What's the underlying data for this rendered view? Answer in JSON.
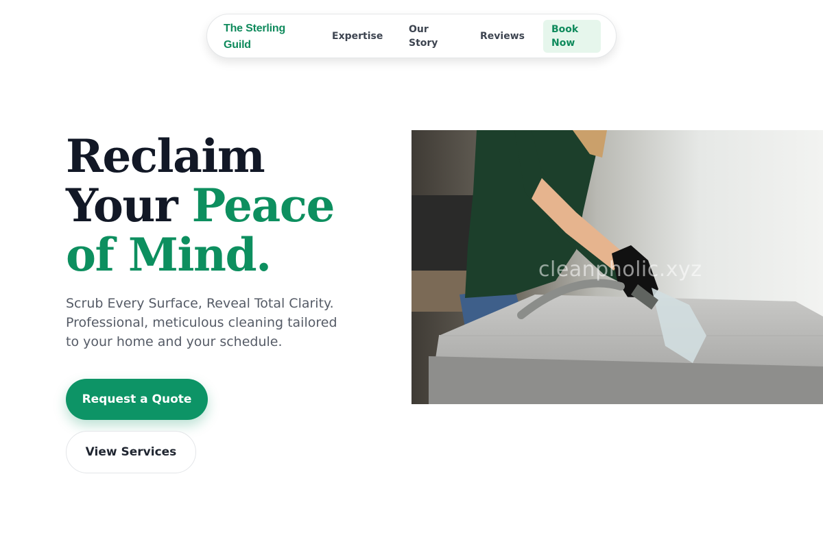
{
  "nav": {
    "brand": "The Sterling Guild",
    "links": [
      {
        "label": "Expertise"
      },
      {
        "label": "Our Story"
      },
      {
        "label": "Reviews"
      }
    ],
    "cta": "Book Now"
  },
  "hero": {
    "title_line1": "Reclaim",
    "title_line2_plain": "Your ",
    "title_line2_accent": "Peace",
    "title_line3_accent": "of Mind.",
    "subtitle": "Scrub Every Surface, Reveal Total Clarity. Professional, meticulous cleaning tailored to your home and your schedule.",
    "primary_button": "Request a Quote",
    "secondary_button": "View Services",
    "image_watermark": "cleanpholic.xyz"
  },
  "colors": {
    "brand_green": "#0d8f5f",
    "button_green": "#0d9466",
    "dark_text": "#121826",
    "book_now_bg": "#e6f6ec"
  }
}
